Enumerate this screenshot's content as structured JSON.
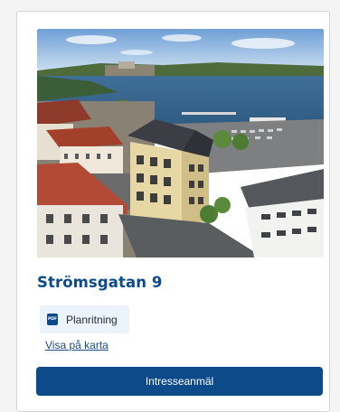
{
  "property": {
    "title": "Strömsgatan 9",
    "image_alt": "Flygbild över Strömsgatan 9"
  },
  "documents": [
    {
      "label": "Planritning",
      "icon": "pdf-icon",
      "icon_text": "PDF"
    }
  ],
  "links": {
    "map_label": "Visa på karta"
  },
  "actions": {
    "interest_label": "Intresseanmäl"
  },
  "colors": {
    "brand": "#0d4a8a",
    "chip_bg": "#edf3fa",
    "page_bg": "#f4f4f4",
    "card_border": "#d4d4d4"
  }
}
